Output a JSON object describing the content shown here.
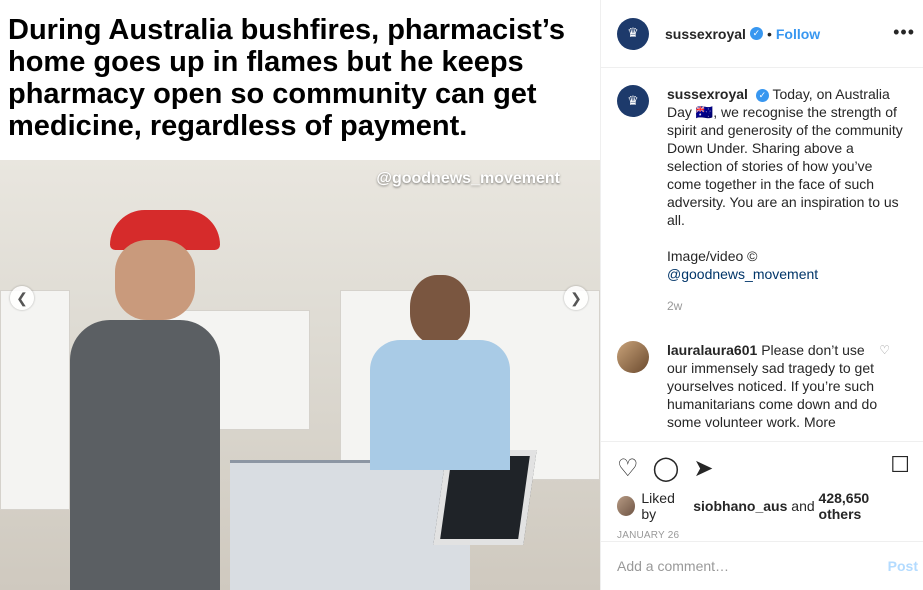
{
  "media": {
    "headline": "During Australia bushfires, pharmacist’s home goes up in flames but he keeps pharmacy open so community can get medicine, regardless of payment.",
    "watermark": "@goodnews_movement",
    "prev_icon": "chevron-left-icon",
    "next_icon": "chevron-right-icon"
  },
  "header": {
    "username": "sussexroyal",
    "dot": "•",
    "follow_label": "Follow",
    "more_label": "•••"
  },
  "caption": {
    "username": "sussexroyal",
    "text1": "Today, on Australia Day 🇦🇺, we recognise the strength of spirit and generosity of the community Down Under. Sharing above a selection of stories of how you’ve come together in the face of such adversity. You are an inspiration to us all.",
    "text2": "Image/video ©",
    "link": "@goodnews_movement",
    "time": "2w"
  },
  "comment": {
    "username": "lauralaura601",
    "text": "Please don’t use our immensely sad tragedy to get yourselves noticed. If you’re such humanitarians come down and do some volunteer work. More"
  },
  "actions": {
    "liked_prefix": "Liked by",
    "liked_user": "siobhano_aus",
    "liked_mid": "and",
    "liked_count": "428,650 others",
    "date": "JANUARY 26"
  },
  "add_comment": {
    "placeholder": "Add a comment…",
    "post_label": "Post"
  },
  "colors": {
    "link": "#3897f0",
    "verified": "#3897f0",
    "post_disabled": "#b3dbff"
  }
}
